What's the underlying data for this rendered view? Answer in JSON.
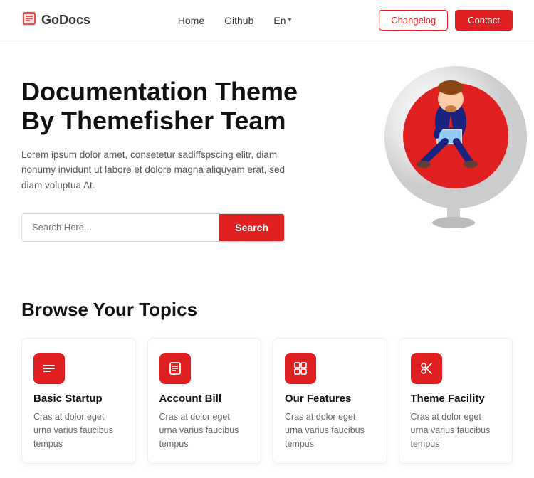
{
  "navbar": {
    "brand_name": "GoDocs",
    "nav_links": [
      {
        "label": "Home",
        "href": "#"
      },
      {
        "label": "Github",
        "href": "#"
      },
      {
        "label": "En",
        "dropdown": true
      }
    ],
    "changelog_label": "Changelog",
    "contact_label": "Contact"
  },
  "hero": {
    "title_line1": "Documentation Theme",
    "title_line2": "By Themefisher Team",
    "description": "Lorem ipsum dolor amet, consetetur sadiffspscing elitr, diam nonumy invidunt ut labore et dolore magna aliquyam erat, sed diam voluptua At.",
    "search_placeholder": "Search Here...",
    "search_button": "Search"
  },
  "browse": {
    "title": "Browse Your Topics",
    "cards": [
      {
        "icon": "≡",
        "title": "Basic Startup",
        "desc": "Cras at dolor eget urna varius faucibus tempus"
      },
      {
        "icon": "▤",
        "title": "Account Bill",
        "desc": "Cras at dolor eget urna varius faucibus tempus"
      },
      {
        "icon": "▣",
        "title": "Our Features",
        "desc": "Cras at dolor eget urna varius faucibus tempus"
      },
      {
        "icon": "✂",
        "title": "Theme Facility",
        "desc": "Cras at dolor eget urna varius faucibus tempus"
      }
    ]
  }
}
